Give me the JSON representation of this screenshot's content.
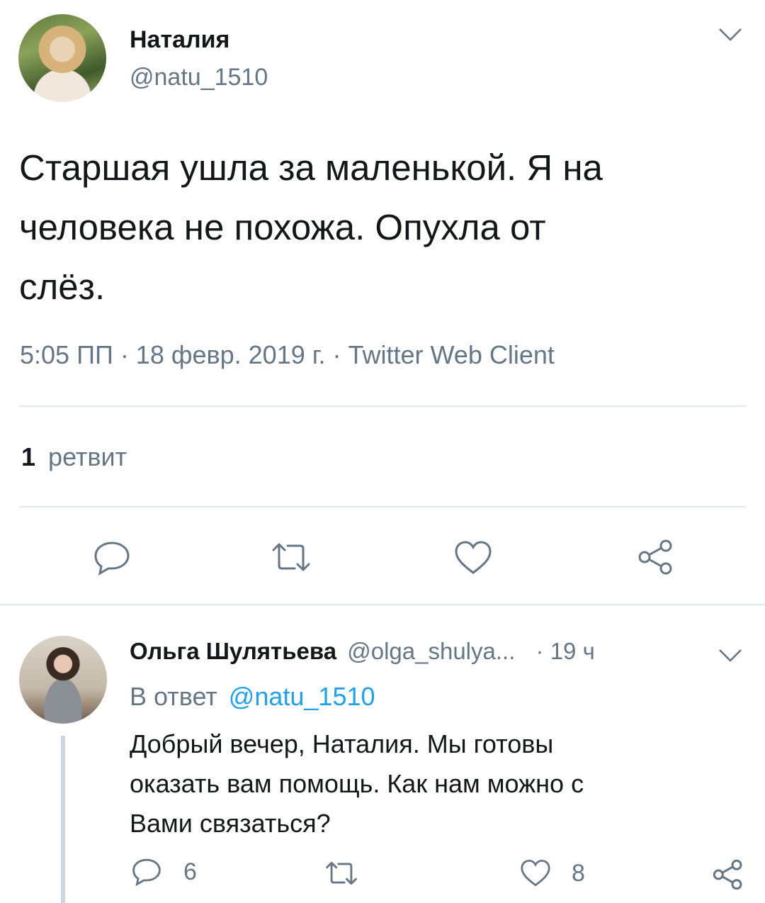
{
  "tweet": {
    "author_name": "Наталия",
    "author_handle": "@natu_1510",
    "text_lines": [
      "Старшая ушла за маленькой. Я на",
      "человека не похожа. Опухла от",
      "слёз."
    ],
    "meta": "5:05 ПП · 18 февр. 2019 г. · Twitter Web Client",
    "retweet_count": "1",
    "retweet_label": "ретвит"
  },
  "reply": {
    "author_name": "Ольга Шулятьева",
    "author_handle": "@olga_shulya...",
    "time": "· 19 ч",
    "reply_to_prefix": "В ответ",
    "reply_to_handle": "@natu_1510",
    "text_lines": [
      "Добрый вечер, Наталия. Мы готовы",
      "оказать вам помощь. Как нам можно с",
      "Вами связаться?"
    ],
    "reply_count": "6",
    "like_count": "8"
  },
  "icons": {
    "menu": "chevron-down-icon",
    "reply": "reply-icon",
    "retweet": "retweet-icon",
    "like": "heart-icon",
    "share": "share-icon"
  },
  "colors": {
    "text": "#14171a",
    "muted": "#657786",
    "link": "#1da1f2",
    "icon": "#657786",
    "divider": "#e1e8ed"
  }
}
